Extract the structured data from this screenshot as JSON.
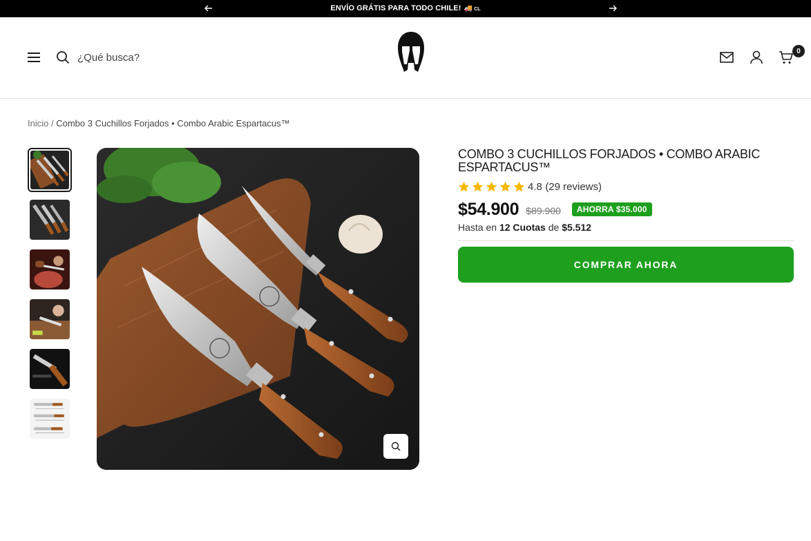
{
  "announcement": {
    "text": "ENVÍO GRÁTIS PARA TODO CHILE!",
    "emoji": "🚚",
    "flag": "CL",
    "prev_icon": "arrow-left-icon",
    "next_icon": "arrow-right-icon"
  },
  "header": {
    "menu_icon": "hamburger-menu-icon",
    "search_icon": "search-icon",
    "search_placeholder": "¿Qué busca?",
    "logo_icon": "spartan-helmet-logo",
    "mail_icon": "mail-icon",
    "account_icon": "user-icon",
    "cart_icon": "cart-icon",
    "cart_count": "0"
  },
  "breadcrumb": {
    "home": "Inicio",
    "separator": "/",
    "current": "Combo 3 Cuchillos Forjados • Combo Arabic Espartacus™"
  },
  "gallery": {
    "thumbnail_count": 6,
    "active_index": 0,
    "zoom_icon": "zoom-in-icon"
  },
  "product": {
    "title": "Combo 3 Cuchillos Forjados • Combo Arabic Espartacus™",
    "rating": "4.8",
    "reviews": "(29 reviews)",
    "price": "$54.900",
    "compare_price": "$89.900",
    "savings_badge": "AHORRA $35.000",
    "installments_prefix": "Hasta en",
    "installments_count": "12 Cuotas",
    "installments_mid": "de",
    "installments_amount": "$5.512",
    "buy_button": "COMPRAR AHORA"
  },
  "colors": {
    "accent_green": "#1ea01e",
    "star_yellow": "#f5b800",
    "announcement_bg": "#000000",
    "text": "#1c1c1c"
  }
}
